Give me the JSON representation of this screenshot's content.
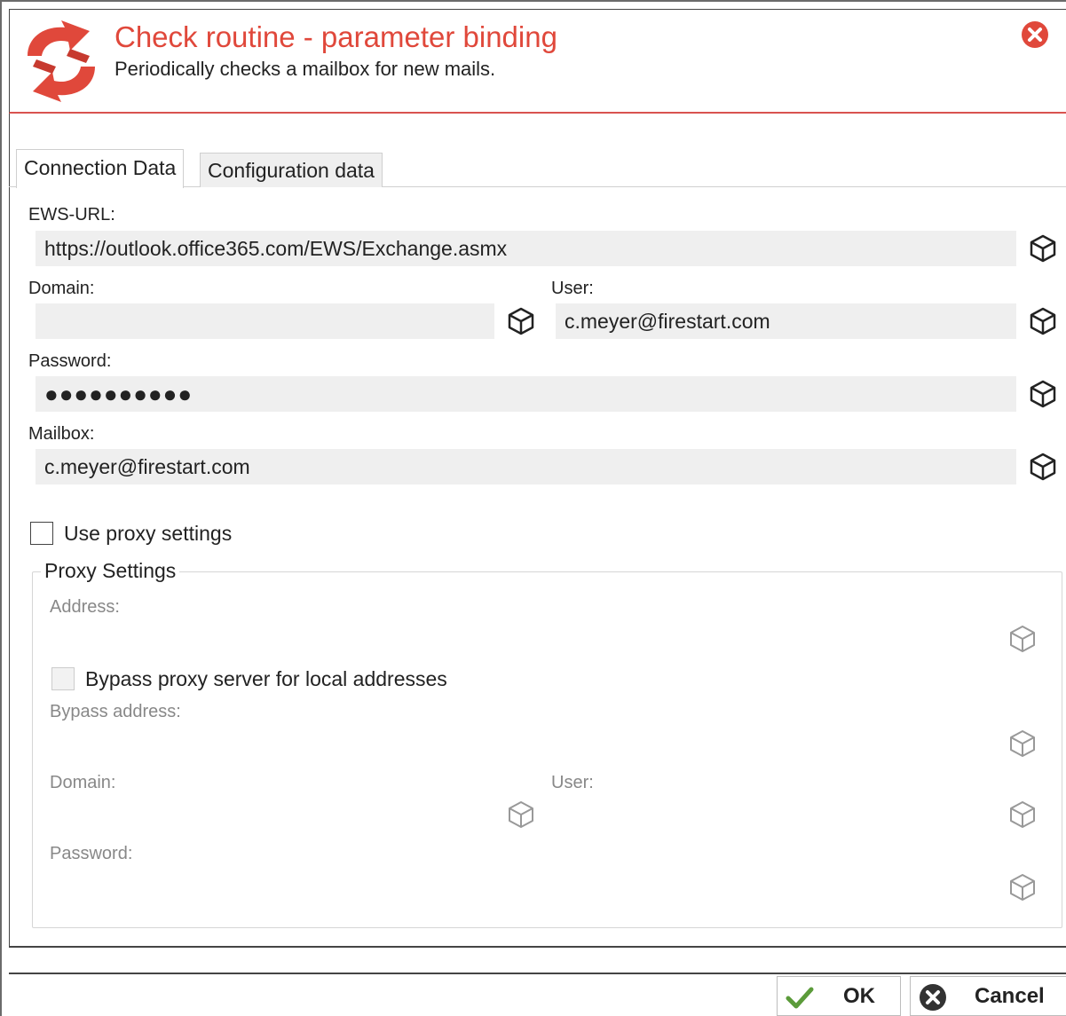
{
  "header": {
    "title": "Check routine - parameter binding",
    "subtitle": "Periodically checks a mailbox for new mails."
  },
  "tabs": [
    {
      "label": "Connection Data",
      "active": true
    },
    {
      "label": "Configuration data",
      "active": false
    }
  ],
  "connection": {
    "ews_url_label": "EWS-URL:",
    "ews_url_value": "https://outlook.office365.com/EWS/Exchange.asmx",
    "domain_label": "Domain:",
    "domain_value": "",
    "user_label": "User:",
    "user_value": "c.meyer@firestart.com",
    "password_label": "Password:",
    "password_value": "●●●●●●●●●●",
    "mailbox_label": "Mailbox:",
    "mailbox_value": "c.meyer@firestart.com"
  },
  "proxy": {
    "use_proxy_label": "Use proxy settings",
    "use_proxy_checked": false,
    "group_title": "Proxy Settings",
    "address_label": "Address:",
    "bypass_local_label": "Bypass proxy server for local addresses",
    "bypass_local_checked": false,
    "bypass_address_label": "Bypass address:",
    "domain_label": "Domain:",
    "user_label": "User:",
    "password_label": "Password:"
  },
  "footer": {
    "ok_label": "OK",
    "cancel_label": "Cancel"
  },
  "colors": {
    "accent": "#e0483b",
    "field_bg": "#efefef",
    "disabled_text": "#888888",
    "ok_check": "#5b9b3a"
  },
  "icons": {
    "logo": "refresh-arrows-icon",
    "close": "close-circle-icon",
    "binding": "cube-icon",
    "ok": "checkmark-icon",
    "cancel": "cancel-circle-icon"
  }
}
